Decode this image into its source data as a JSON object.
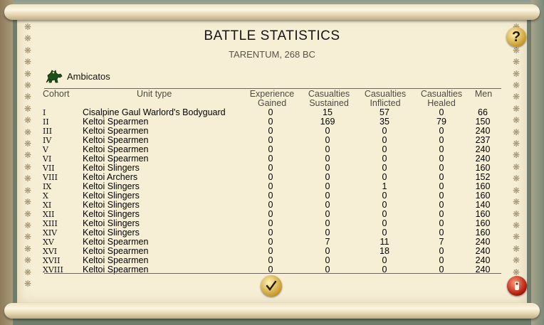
{
  "window": {
    "title": "BATTLE STATISTICS",
    "subtitle": "TARENTUM, 268 BC"
  },
  "general": {
    "name": "Ambicatos",
    "icon": "horse-icon"
  },
  "columns": {
    "cohort": "Cohort",
    "unit_type": "Unit type",
    "experience": [
      "Experience",
      "Gained"
    ],
    "sustained": [
      "Casualties",
      "Sustained"
    ],
    "inflicted": [
      "Casualties",
      "Inflicted"
    ],
    "healed": [
      "Casualties",
      "Healed"
    ],
    "men": "Men"
  },
  "rows": [
    {
      "roman": "I",
      "unit": "Cisalpine Gaul Warlord's Bodyguard",
      "exp": "0",
      "sustained": "15",
      "inflicted": "57",
      "healed": "0",
      "men": "66"
    },
    {
      "roman": "II",
      "unit": "Keltoi Spearmen",
      "exp": "0",
      "sustained": "169",
      "inflicted": "35",
      "healed": "79",
      "men": "150"
    },
    {
      "roman": "III",
      "unit": "Keltoi Spearmen",
      "exp": "0",
      "sustained": "0",
      "inflicted": "0",
      "healed": "0",
      "men": "240"
    },
    {
      "roman": "IV",
      "unit": "Keltoi Spearmen",
      "exp": "0",
      "sustained": "0",
      "inflicted": "0",
      "healed": "0",
      "men": "237"
    },
    {
      "roman": "V",
      "unit": "Keltoi Spearmen",
      "exp": "0",
      "sustained": "0",
      "inflicted": "0",
      "healed": "0",
      "men": "240"
    },
    {
      "roman": "VI",
      "unit": "Keltoi Spearmen",
      "exp": "0",
      "sustained": "0",
      "inflicted": "0",
      "healed": "0",
      "men": "240"
    },
    {
      "roman": "VII",
      "unit": "Keltoi Slingers",
      "exp": "0",
      "sustained": "0",
      "inflicted": "0",
      "healed": "0",
      "men": "160"
    },
    {
      "roman": "VIII",
      "unit": "Keltoi Archers",
      "exp": "0",
      "sustained": "0",
      "inflicted": "0",
      "healed": "0",
      "men": "152"
    },
    {
      "roman": "IX",
      "unit": "Keltoi Slingers",
      "exp": "0",
      "sustained": "0",
      "inflicted": "1",
      "healed": "0",
      "men": "160"
    },
    {
      "roman": "X",
      "unit": "Keltoi Slingers",
      "exp": "0",
      "sustained": "0",
      "inflicted": "0",
      "healed": "0",
      "men": "160"
    },
    {
      "roman": "XI",
      "unit": "Keltoi Slingers",
      "exp": "0",
      "sustained": "0",
      "inflicted": "0",
      "healed": "0",
      "men": "140"
    },
    {
      "roman": "XII",
      "unit": "Keltoi Slingers",
      "exp": "0",
      "sustained": "0",
      "inflicted": "0",
      "healed": "0",
      "men": "160"
    },
    {
      "roman": "XIII",
      "unit": "Keltoi Slingers",
      "exp": "0",
      "sustained": "0",
      "inflicted": "0",
      "healed": "0",
      "men": "160"
    },
    {
      "roman": "XIV",
      "unit": "Keltoi Slingers",
      "exp": "0",
      "sustained": "0",
      "inflicted": "0",
      "healed": "0",
      "men": "160"
    },
    {
      "roman": "XV",
      "unit": "Keltoi Spearmen",
      "exp": "0",
      "sustained": "7",
      "inflicted": "11",
      "healed": "7",
      "men": "240"
    },
    {
      "roman": "XVI",
      "unit": "Keltoi Spearmen",
      "exp": "0",
      "sustained": "0",
      "inflicted": "18",
      "healed": "0",
      "men": "240"
    },
    {
      "roman": "XVII",
      "unit": "Keltoi Spearmen",
      "exp": "0",
      "sustained": "0",
      "inflicted": "0",
      "healed": "0",
      "men": "240"
    },
    {
      "roman": "XVIII",
      "unit": "Keltoi Spearmen",
      "exp": "0",
      "sustained": "0",
      "inflicted": "0",
      "healed": "0",
      "men": "240"
    }
  ],
  "buttons": {
    "help": {
      "label": "?",
      "icon": "question-mark-icon"
    },
    "confirm": {
      "icon": "checkmark-icon"
    },
    "close": {
      "icon": "exit-icon"
    }
  },
  "colors": {
    "parchment": "#f6efd6",
    "gold": "#c79a2a",
    "close_red": "#b21c0e"
  }
}
